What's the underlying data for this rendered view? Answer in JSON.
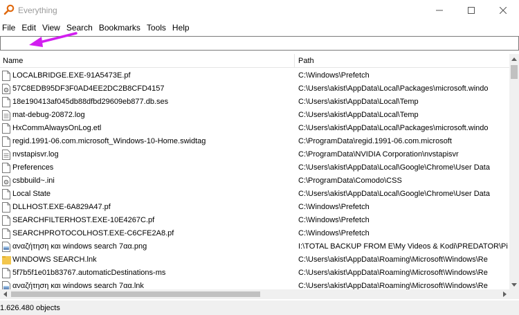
{
  "window": {
    "title": "Everything",
    "controls": [
      "minimize-icon",
      "maximize-icon",
      "close-icon"
    ]
  },
  "menu": [
    "File",
    "Edit",
    "View",
    "Search",
    "Bookmarks",
    "Tools",
    "Help"
  ],
  "search": {
    "value": "",
    "placeholder": ""
  },
  "columns": {
    "name": "Name",
    "path": "Path"
  },
  "rows": [
    {
      "name": "LOCALBRIDGE.EXE-91A5473E.pf",
      "path": "C:\\Windows\\Prefetch",
      "icon": "file-icon"
    },
    {
      "name": "57C8EDB95DF3F0AD4EE2DC2B8CFD4157",
      "path": "C:\\Users\\akist\\AppData\\Local\\Packages\\microsoft.windo",
      "icon": "settings-file-icon"
    },
    {
      "name": "18e190413af045db88dfbd29609eb877.db.ses",
      "path": "C:\\Users\\akist\\AppData\\Local\\Temp",
      "icon": "file-icon"
    },
    {
      "name": "mat-debug-20872.log",
      "path": "C:\\Users\\akist\\AppData\\Local\\Temp",
      "icon": "text-file-icon"
    },
    {
      "name": "HxCommAlwaysOnLog.etl",
      "path": "C:\\Users\\akist\\AppData\\Local\\Packages\\microsoft.windo",
      "icon": "file-icon"
    },
    {
      "name": "regid.1991-06.com.microsoft_Windows-10-Home.swidtag",
      "path": "C:\\ProgramData\\regid.1991-06.com.microsoft",
      "icon": "file-icon"
    },
    {
      "name": "nvstapisvr.log",
      "path": "C:\\ProgramData\\NVIDIA Corporation\\nvstapisvr",
      "icon": "text-file-icon"
    },
    {
      "name": "Preferences",
      "path": "C:\\Users\\akist\\AppData\\Local\\Google\\Chrome\\User Data",
      "icon": "file-icon"
    },
    {
      "name": "csbbuild~.ini",
      "path": "C:\\ProgramData\\Comodo\\CSS",
      "icon": "settings-file-icon"
    },
    {
      "name": "Local State",
      "path": "C:\\Users\\akist\\AppData\\Local\\Google\\Chrome\\User Data",
      "icon": "file-icon"
    },
    {
      "name": "DLLHOST.EXE-6A829A47.pf",
      "path": "C:\\Windows\\Prefetch",
      "icon": "file-icon"
    },
    {
      "name": "SEARCHFILTERHOST.EXE-10E4267C.pf",
      "path": "C:\\Windows\\Prefetch",
      "icon": "file-icon"
    },
    {
      "name": "SEARCHPROTOCOLHOST.EXE-C6CFE2A8.pf",
      "path": "C:\\Windows\\Prefetch",
      "icon": "file-icon"
    },
    {
      "name": "αναζήτηση και windows search 7αα.png",
      "path": "I:\\TOTAL BACKUP FROM E\\My Videos & Kodi\\PREDATOR\\Pi",
      "icon": "image-file-icon"
    },
    {
      "name": "WINDOWS SEARCH.lnk",
      "path": "C:\\Users\\akist\\AppData\\Roaming\\Microsoft\\Windows\\Re",
      "icon": "folder-shortcut-icon"
    },
    {
      "name": "5f7b5f1e01b83767.automaticDestinations-ms",
      "path": "C:\\Users\\akist\\AppData\\Roaming\\Microsoft\\Windows\\Re",
      "icon": "file-icon"
    },
    {
      "name": "αναζήτηση και windows search 7αα.lnk",
      "path": "C:\\Users\\akist\\AppData\\Roaming\\Microsoft\\Windows\\Re",
      "icon": "image-file-icon"
    }
  ],
  "status": {
    "text": "1.626.480 objects"
  },
  "colors": {
    "arrow": "#d21ef0",
    "app_icon": "#e06a10",
    "scroll_thumb": "#c1c1c1"
  }
}
